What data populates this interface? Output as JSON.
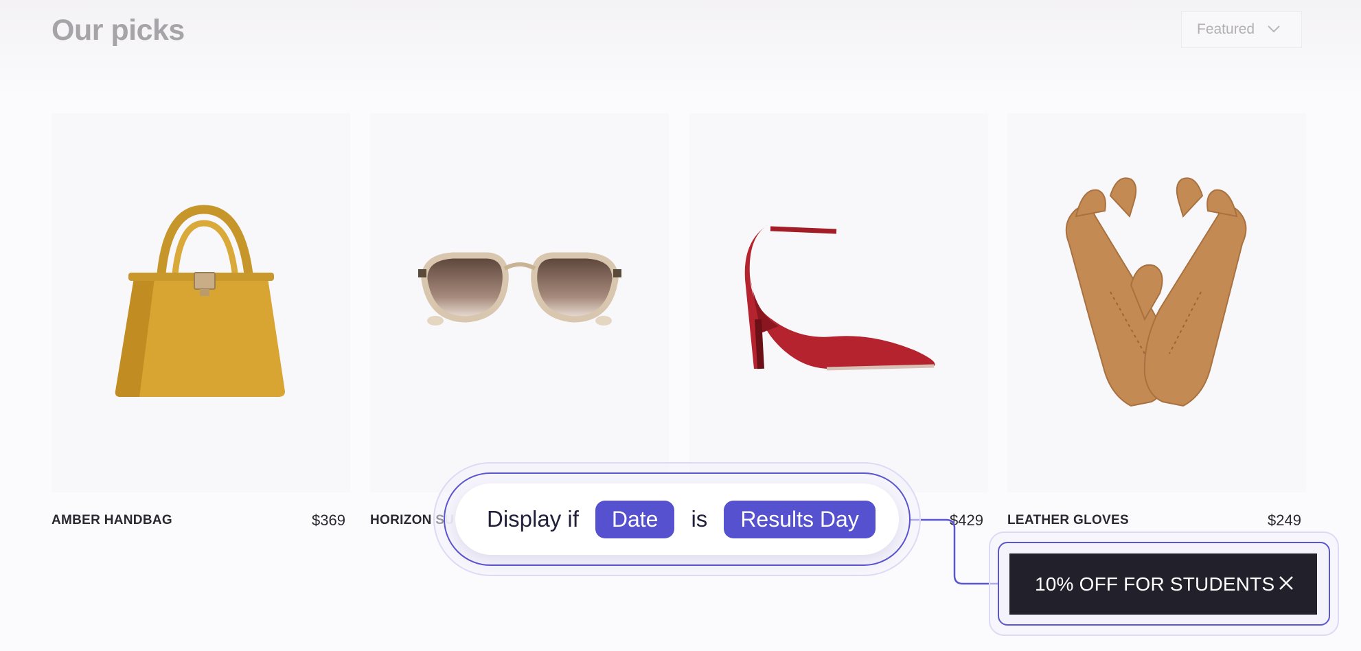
{
  "header": {
    "title": "Our picks",
    "sort": {
      "selected": "Featured"
    }
  },
  "products": [
    {
      "name": "AMBER HANDBAG",
      "price": "$369",
      "image": "handbag-image"
    },
    {
      "name": "HORIZON SU",
      "price": "",
      "image": "sunglasses-image"
    },
    {
      "name": "",
      "price": "$429",
      "image": "red-heel-image"
    },
    {
      "name": "LEATHER GLOVES",
      "price": "$249",
      "image": "gloves-image"
    }
  ],
  "condition": {
    "prefix": "Display if",
    "field": "Date",
    "operator": "is",
    "value": "Results Day"
  },
  "banner": {
    "text": "10% OFF FOR STUDENTS"
  },
  "colors": {
    "accent": "#5651cf",
    "banner_bg": "#22202a"
  }
}
